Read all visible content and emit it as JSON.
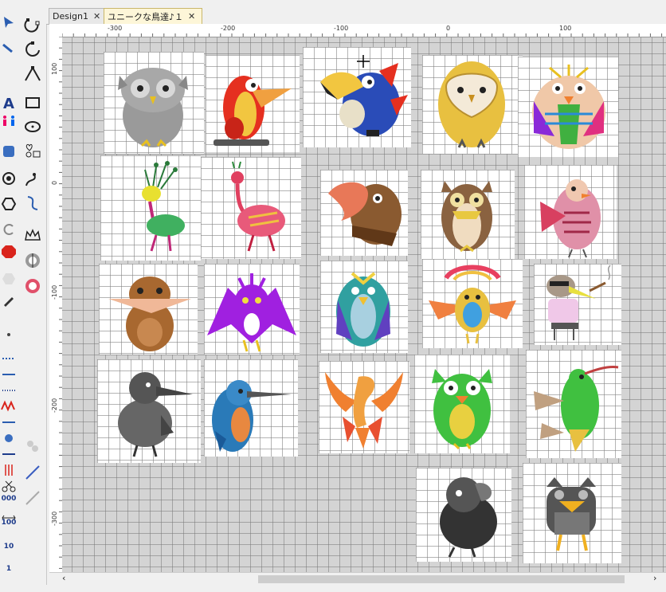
{
  "tabs": [
    {
      "label": "Design1",
      "close": "✕",
      "active": false
    },
    {
      "label": "ユニークな鳥達♪１",
      "close": "✕",
      "active": true
    }
  ],
  "ruler_top": {
    "labels": [
      "-300",
      "-200",
      "-100",
      "0",
      "100"
    ]
  },
  "ruler_left": {
    "labels": [
      "100",
      "0",
      "-100",
      "-200",
      "-300"
    ]
  },
  "left_toolbar": {
    "labels": [
      "000",
      "100",
      "10",
      "1"
    ]
  },
  "canvas": {
    "background": "#d4d4d4",
    "tile_color": "#ffffff"
  },
  "designs": [
    {
      "name": "gray-owl"
    },
    {
      "name": "red-toucan"
    },
    {
      "name": "blue-toucan"
    },
    {
      "name": "barn-owl"
    },
    {
      "name": "striped-owl"
    },
    {
      "name": "peacock"
    },
    {
      "name": "flamingo-bird"
    },
    {
      "name": "hooked-parrot"
    },
    {
      "name": "brown-owl"
    },
    {
      "name": "pink-bird"
    },
    {
      "name": "brown-bird"
    },
    {
      "name": "purple-bat-bird"
    },
    {
      "name": "green-parrot"
    },
    {
      "name": "rainbow-bird"
    },
    {
      "name": "smoking-bird"
    },
    {
      "name": "black-crow"
    },
    {
      "name": "kingfisher"
    },
    {
      "name": "phoenix"
    },
    {
      "name": "green-owl"
    },
    {
      "name": "hummingbird"
    },
    {
      "name": "black-crow-2"
    },
    {
      "name": "gray-owl-2"
    }
  ]
}
